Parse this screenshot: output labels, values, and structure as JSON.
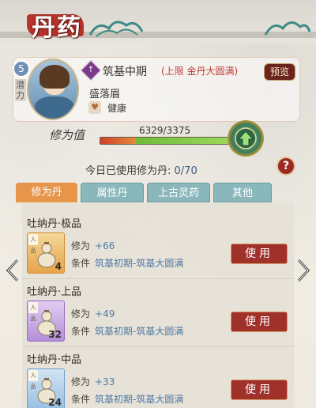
{
  "header": {
    "title": "丹药"
  },
  "character": {
    "level": "5",
    "potential_label": "潜力",
    "realm_icon_glyph": "↑",
    "realm": "筑基中期",
    "realm_limit": "(上限 金丹大圆满)",
    "preview_label": "预览",
    "name": "盛落眉",
    "health_icon_glyph": "♥",
    "health": "健康"
  },
  "cultivation": {
    "label": "修为值",
    "value_text": "6329/3375",
    "progress_red_fraction": 0.28,
    "progress_green_fraction": 0.72
  },
  "usage": {
    "label": "今日已使用修为丹:",
    "count": "0/70"
  },
  "help_label": "?",
  "tabs": [
    {
      "label": "修为丹"
    },
    {
      "label": "属性丹"
    },
    {
      "label": "上古灵药"
    },
    {
      "label": "其他"
    }
  ],
  "items": [
    {
      "name": "吐纳丹·极品",
      "tag": "人品",
      "qty": "4",
      "effect_key": "修为",
      "effect_value": "+66",
      "condition_key": "条件",
      "condition_value": "筑基初期-筑基大圆满",
      "use_label": "使用",
      "frame": "gold"
    },
    {
      "name": "吐纳丹·上品",
      "tag": "人品",
      "qty": "32",
      "effect_key": "修为",
      "effect_value": "+49",
      "condition_key": "条件",
      "condition_value": "筑基初期-筑基大圆满",
      "use_label": "使用",
      "frame": "purple"
    },
    {
      "name": "吐纳丹·中品",
      "tag": "人品",
      "qty": "24",
      "effect_key": "修为",
      "effect_value": "+33",
      "condition_key": "条件",
      "condition_value": "筑基初期-筑基大圆满",
      "use_label": "使用",
      "frame": "blue"
    }
  ],
  "colors": {
    "accent_red": "#a0302a",
    "tab_active": "#e7954b",
    "tab_inactive": "#8ab7bb",
    "value_blue": "#4f79a3"
  }
}
